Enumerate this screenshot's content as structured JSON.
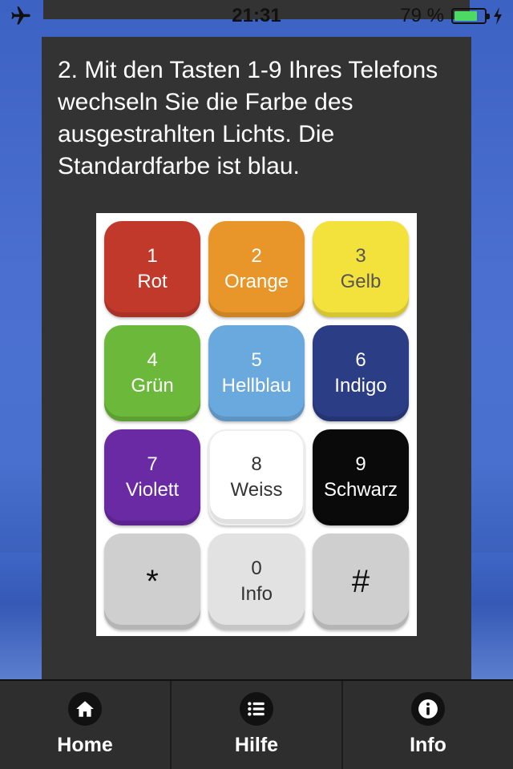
{
  "status_bar": {
    "time": "21:31",
    "battery_percent": "79 %",
    "battery_level": 0.79,
    "airplane_mode_icon": "airplane-icon",
    "charging_icon": "bolt-icon"
  },
  "instruction_text": "2. Mit den Tasten 1-9 Ihres Telefons wechseln Sie die Farbe des ausgestrahlten Lichts. Die Standardfarbe ist blau.",
  "keypad": {
    "keys": [
      {
        "number": "1",
        "label": "Rot",
        "color": "#c0392b"
      },
      {
        "number": "2",
        "label": "Orange",
        "color": "#e8962a"
      },
      {
        "number": "3",
        "label": "Gelb",
        "color": "#f3e13c"
      },
      {
        "number": "4",
        "label": "Grün",
        "color": "#6cb83a"
      },
      {
        "number": "5",
        "label": "Hellblau",
        "color": "#6aa9dd"
      },
      {
        "number": "6",
        "label": "Indigo",
        "color": "#2b3d85"
      },
      {
        "number": "7",
        "label": "Violett",
        "color": "#6a2aa3"
      },
      {
        "number": "8",
        "label": "Weiss",
        "color": "#ffffff"
      },
      {
        "number": "9",
        "label": "Schwarz",
        "color": "#0a0a0a"
      },
      {
        "number": "*",
        "label": "",
        "color": "#cfcfcf"
      },
      {
        "number": "0",
        "label": "Info",
        "color": "#e2e2e2"
      },
      {
        "number": "#",
        "label": "",
        "color": "#cfcfcf"
      }
    ]
  },
  "tabbar": {
    "tabs": [
      {
        "label": "Home",
        "icon": "home-icon"
      },
      {
        "label": "Hilfe",
        "icon": "list-icon"
      },
      {
        "label": "Info",
        "icon": "info-icon"
      }
    ]
  }
}
